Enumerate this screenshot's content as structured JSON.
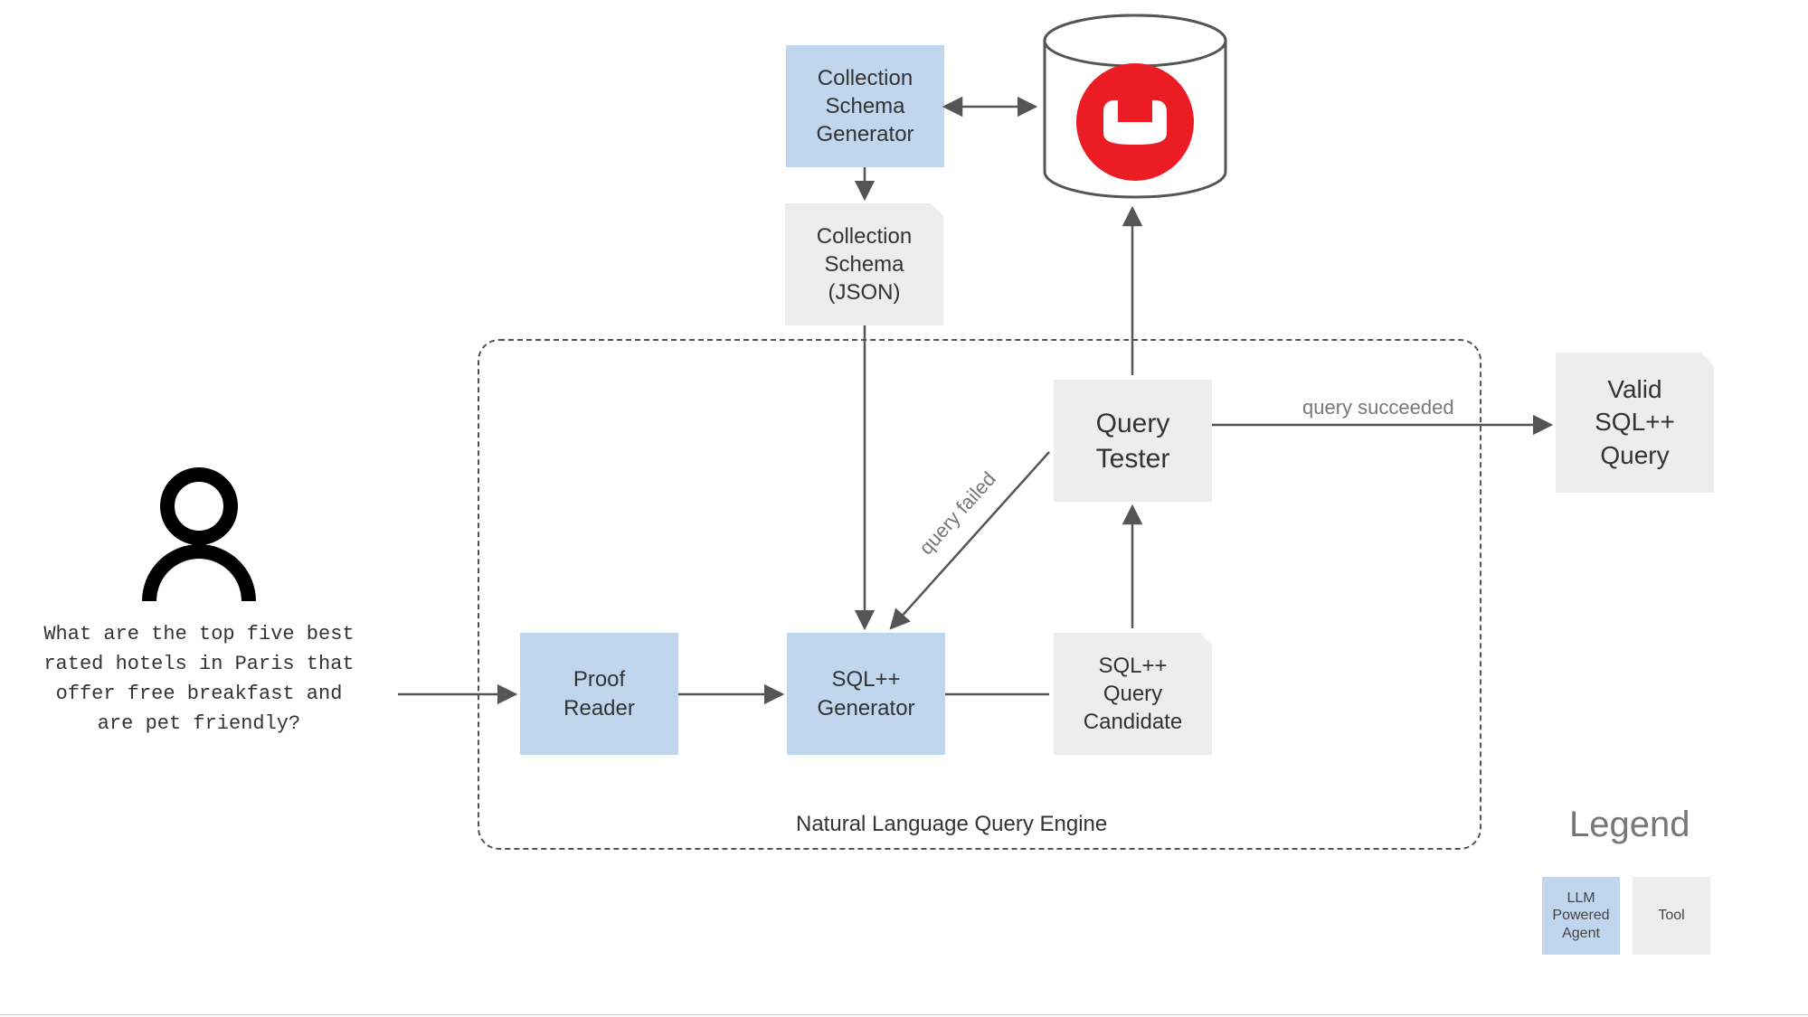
{
  "user_query": "What are the top five best\nrated hotels in Paris that\noffer free breakfast and\nare pet friendly?",
  "nodes": {
    "collection_schema_generator": "Collection\nSchema\nGenerator",
    "collection_schema_json": "Collection\nSchema\n(JSON)",
    "proof_reader": "Proof\nReader",
    "sqlpp_generator": "SQL++\nGenerator",
    "sqlpp_query_candidate": "SQL++\nQuery\nCandidate",
    "query_tester": "Query\nTester",
    "valid_sqlpp_query": "Valid\nSQL++\nQuery"
  },
  "engine_label": "Natural Language Query Engine",
  "edges": {
    "query_failed": "query failed",
    "query_succeeded": "query succeeded"
  },
  "legend": {
    "title": "Legend",
    "llm_agent": "LLM\nPowered\nAgent",
    "tool": "Tool"
  }
}
